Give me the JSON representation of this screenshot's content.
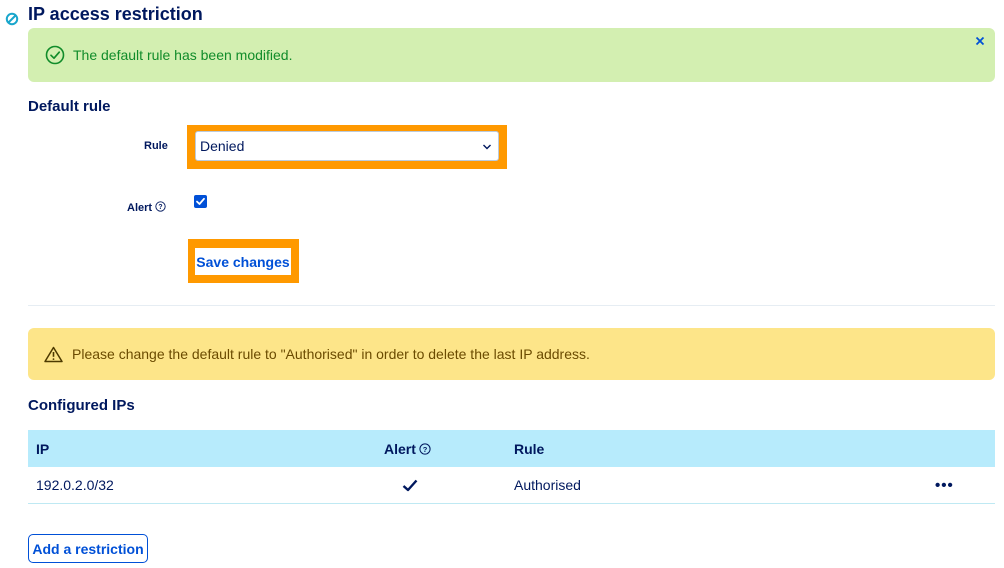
{
  "page": {
    "title": "IP access restriction"
  },
  "success_alert": {
    "message": "The default rule has been modified.",
    "close_symbol": "×"
  },
  "default_rule": {
    "heading": "Default rule",
    "rule_label": "Rule",
    "rule_value": "Denied",
    "rule_options": [
      "Denied"
    ],
    "alert_label": "Alert",
    "alert_checked": true,
    "save_label": "Save changes"
  },
  "warning_alert": {
    "message": "Please change the default rule to \"Authorised\" in order to delete the last IP address."
  },
  "configured_ips": {
    "heading": "Configured IPs",
    "columns": {
      "ip": "IP",
      "alert": "Alert",
      "rule": "Rule"
    },
    "rows": [
      {
        "ip": "192.0.2.0/32",
        "alert": true,
        "rule": "Authorised",
        "actions": "•••"
      }
    ],
    "add_label": "Add a restriction"
  },
  "colors": {
    "primary": "#0050d7",
    "text": "#00185e",
    "success_bg": "#d3efb1",
    "success_text": "#118c2a",
    "warning_bg": "#fde589",
    "table_header_bg": "#b7ebfc",
    "highlight": "#ff9900"
  },
  "icons": {
    "title": "prohibited-icon",
    "success": "check-circle-icon",
    "close": "close-icon",
    "warning": "warning-triangle-icon",
    "help": "help-circle-icon",
    "dropdown": "chevron-down-icon",
    "check": "checkmark-icon",
    "more": "ellipsis-icon"
  }
}
